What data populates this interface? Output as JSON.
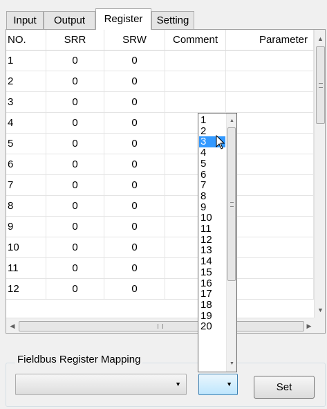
{
  "tabs": [
    {
      "label": "Input"
    },
    {
      "label": "Output"
    },
    {
      "label": "Register"
    },
    {
      "label": "Setting"
    }
  ],
  "grid": {
    "columns": [
      "NO.",
      "SRR",
      "SRW",
      "Comment",
      "Parameter"
    ],
    "rows": [
      {
        "no": "1",
        "srr": "0",
        "srw": "0"
      },
      {
        "no": "2",
        "srr": "0",
        "srw": "0"
      },
      {
        "no": "3",
        "srr": "0",
        "srw": "0"
      },
      {
        "no": "4",
        "srr": "0",
        "srw": "0"
      },
      {
        "no": "5",
        "srr": "0",
        "srw": "0"
      },
      {
        "no": "6",
        "srr": "0",
        "srw": "0"
      },
      {
        "no": "7",
        "srr": "0",
        "srw": "0"
      },
      {
        "no": "8",
        "srr": "0",
        "srw": "0"
      },
      {
        "no": "9",
        "srr": "0",
        "srw": "0"
      },
      {
        "no": "10",
        "srr": "0",
        "srw": "0"
      },
      {
        "no": "11",
        "srr": "0",
        "srw": "0"
      },
      {
        "no": "12",
        "srr": "0",
        "srw": "0"
      }
    ]
  },
  "mapping": {
    "group_label": "Fieldbus Register Mapping",
    "combo_value": "",
    "number_combo_value": "",
    "set_label": "Set"
  },
  "dropdown": {
    "items": [
      "1",
      "2",
      "3",
      "4",
      "5",
      "6",
      "7",
      "8",
      "9",
      "10",
      "11",
      "12",
      "13",
      "14",
      "15",
      "16",
      "17",
      "18",
      "19",
      "20"
    ],
    "selected": "3",
    "selected_color": "#3399ff"
  }
}
